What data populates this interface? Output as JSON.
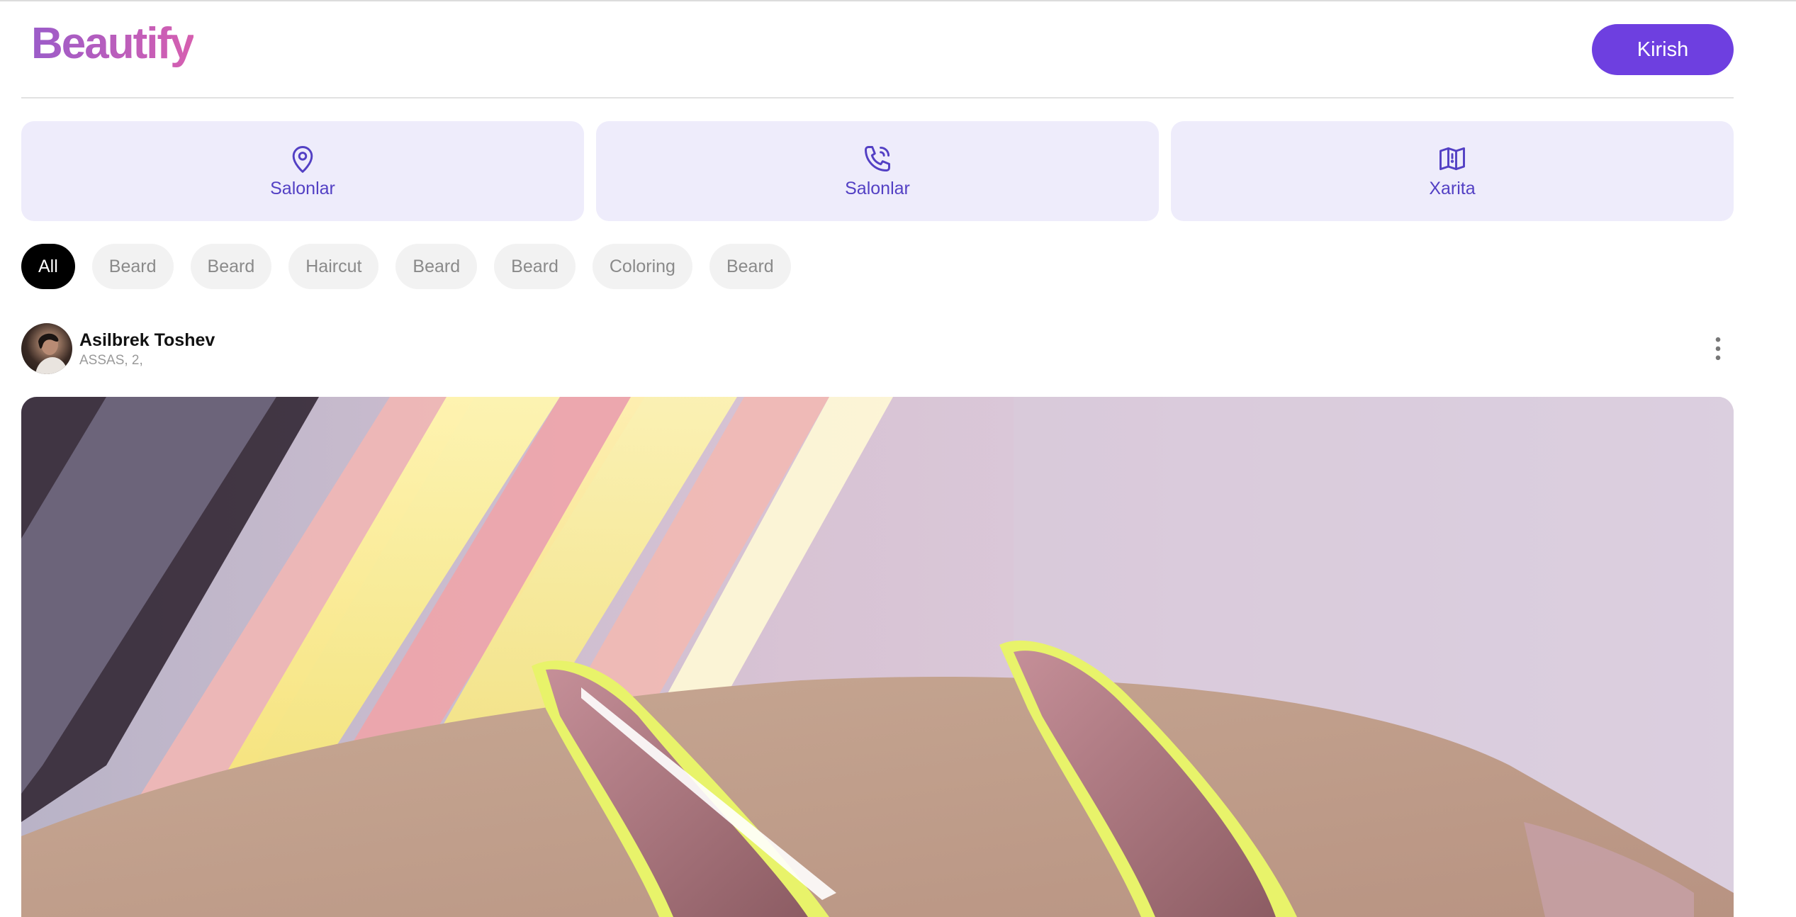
{
  "header": {
    "logo": "Beautify",
    "login_label": "Kirish"
  },
  "cards": [
    {
      "icon": "location-pin-icon",
      "label": "Salonlar"
    },
    {
      "icon": "phone-call-icon",
      "label": "Salonlar"
    },
    {
      "icon": "map-icon",
      "label": "Xarita"
    }
  ],
  "filters": {
    "selected": "All",
    "items": [
      "All",
      "Beard",
      "Beard",
      "Haircut",
      "Beard",
      "Beard",
      "Coloring",
      "Beard"
    ]
  },
  "post": {
    "author_name": "Asilbrek Toshev",
    "author_location": "ASSAS, 2,",
    "menu_icon": "more-vertical-icon",
    "image_subject": "manicured-nails-photo"
  },
  "colors": {
    "accent": "#6e3fe0",
    "card_bg": "#eeecfb",
    "card_text": "#5340c4",
    "chip_bg": "#f2f2f2",
    "chip_active_bg": "#000000"
  }
}
